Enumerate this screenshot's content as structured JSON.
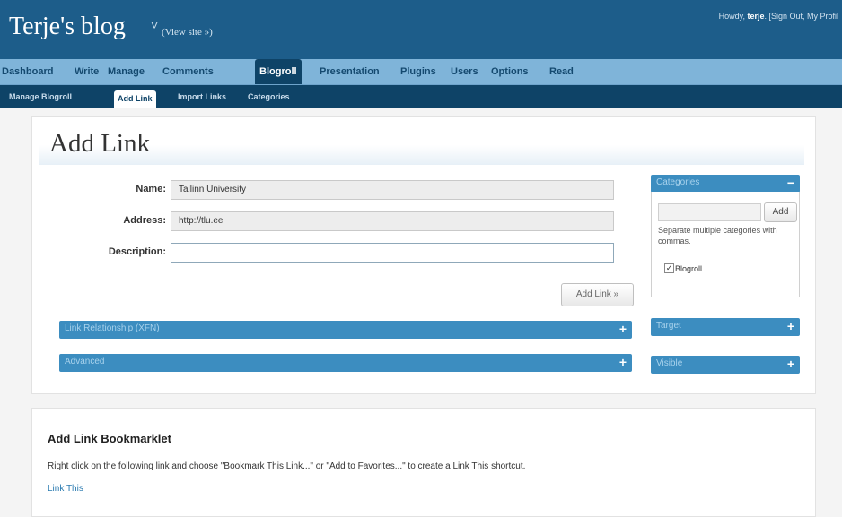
{
  "header": {
    "blog_title": "Terje's blog",
    "title_arrow": "˅",
    "view_site": "(View site »)",
    "howdy_prefix": "Howdy, ",
    "user": "terje",
    "howdy_links": ". [Sign Out, My Profil"
  },
  "main_nav": [
    "Dashboard",
    "Write",
    "Manage",
    "Comments",
    "Blogroll",
    "Presentation",
    "Plugins",
    "Users",
    "Options",
    "Read"
  ],
  "sub_nav": [
    "Manage Blogroll",
    "Add Link",
    "Import Links",
    "Categories"
  ],
  "page_title": "Add Link",
  "form": {
    "name_label": "Name:",
    "name_value": "Tallinn University",
    "address_label": "Address:",
    "address_value": "http://tlu.ee",
    "description_label": "Description:",
    "description_value": "",
    "submit_label": "Add Link »"
  },
  "sections": {
    "link_relationship": "Link Relationship (XFN)",
    "advanced": "Advanced",
    "plus": "+",
    "minus": "−"
  },
  "sidebar": {
    "categories": "Categories",
    "add_label": "Add",
    "note": "Separate multiple categories with commas.",
    "checkbox_label": "Blogroll",
    "checkbox_checked": true,
    "target": "Target",
    "visible": "Visible"
  },
  "bookmarklet": {
    "title": "Add Link Bookmarklet",
    "text": "Right click on the following link and choose \"Bookmark This Link...\" or \"Add to Favorites...\" to create a Link This shortcut.",
    "link": "Link This"
  },
  "colors": {
    "header_bg": "#1d5d8a",
    "nav_bg": "#7fb4d9",
    "subnav_bg": "#0e4367",
    "bar_blue": "#3c8dc0"
  }
}
